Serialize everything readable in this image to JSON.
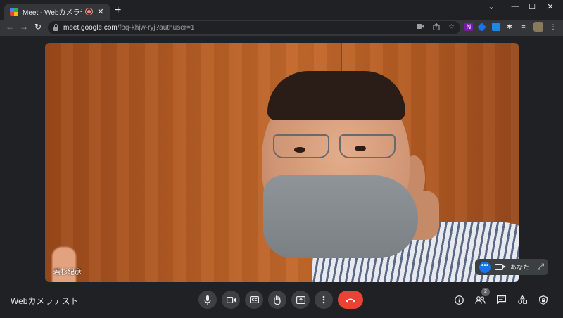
{
  "browser": {
    "tab_title": "Meet - Webカメラテスト",
    "close_glyph": "✕",
    "new_tab_glyph": "+",
    "window": {
      "minimize": "—",
      "maximize": "☐",
      "close": "✕"
    },
    "nav": {
      "back": "←",
      "forward": "→",
      "reload": "↻"
    },
    "url_host": "meet.google.com",
    "url_path": "/fbq-khjw-ryj?authuser=1",
    "omnibox_icons": [
      "camera-icon",
      "share-icon",
      "star-icon"
    ],
    "star_glyph": "☆",
    "extensions": [
      "onenote-extension-icon",
      "extension-icon-2",
      "extension-icon-3",
      "puzzle-icon",
      "reading-list-icon",
      "profile-avatar"
    ],
    "extension_glyphs": {
      "onenote": "N",
      "puzzle": "✱",
      "reading_list": "≡"
    }
  },
  "meeting": {
    "title": "Webカメラテスト",
    "speaker_name": "若杉紀彦",
    "self_label": "あなた",
    "self_tile_more": "•••",
    "expand_glyph": "⤢",
    "participants_count": "2",
    "controls": [
      "microphone-button",
      "camera-button",
      "captions-button",
      "raise-hand-button",
      "present-button",
      "more-options-button",
      "leave-call-button"
    ],
    "right_controls": [
      "meeting-info-button",
      "people-button",
      "chat-button",
      "activities-button",
      "host-controls-button"
    ],
    "end_call_color": "#ea4335",
    "accent_color": "#1a73e8"
  }
}
